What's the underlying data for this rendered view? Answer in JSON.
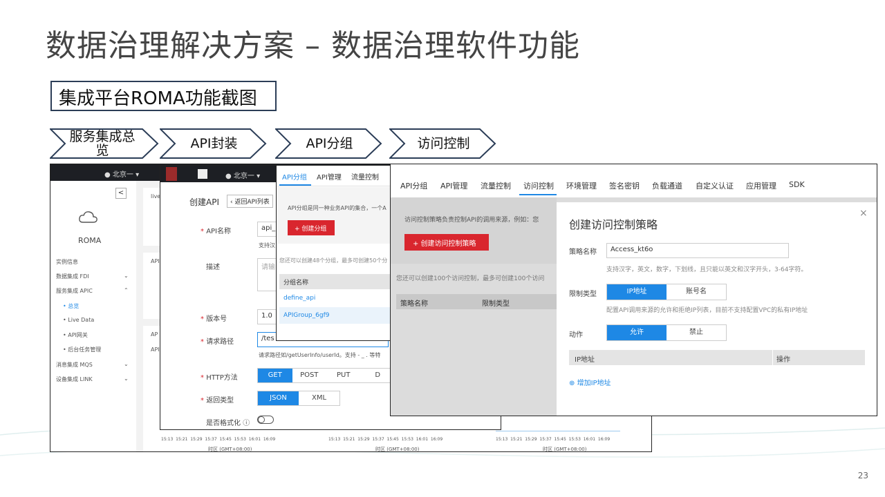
{
  "slide": {
    "title": "数据治理解决方案 – 数据治理软件功能",
    "subtitle": "集成平台ROMA功能截图",
    "page_number": "23"
  },
  "steps": [
    "服务集成总览",
    "API封装",
    "API分组",
    "访问控制"
  ],
  "win1": {
    "region": "北京一",
    "logo_text": "ROMA",
    "sidebar": [
      "实例信息",
      "数据集成 FDI",
      "服务集成 APIC",
      "• 总览",
      "• Live Data",
      "• API网关",
      "• 后台任务管理",
      "消息集成 MQS",
      "设备集成 LINK"
    ],
    "card_labels": [
      "live",
      "API",
      "AP",
      "API"
    ],
    "time_ticks": [
      "15:13",
      "15:21",
      "15:29",
      "15:37",
      "15:45",
      "15:53",
      "16:01",
      "16:09"
    ],
    "time_zone": "时区 (GMT+08:00)",
    "y_tick": "15"
  },
  "win2": {
    "region": "北京一",
    "page_title": "创建API",
    "back_label": "返回API列表",
    "api_name_label": "API名称",
    "api_name_value": "api_",
    "api_name_hint": "支持汉",
    "desc_label": "描述",
    "desc_placeholder": "请输",
    "version_label": "版本号",
    "version_value": "1.0",
    "path_label": "请求路径",
    "path_value": "/tes",
    "path_hint": "请求路径如/getUserInfo/userId。支持 - _ . 等特",
    "method_label": "HTTP方法",
    "methods": [
      "GET",
      "POST",
      "PUT",
      "D"
    ],
    "return_label": "返回类型",
    "return_types": [
      "JSON",
      "XML"
    ],
    "format_label": "是否格式化"
  },
  "win3": {
    "tabs": [
      "API分组",
      "API管理",
      "流量控制"
    ],
    "info": "API分组是同一种业务API的集合，一个A",
    "create_btn": "+ 创建分组",
    "quota": "您还可以创建48个分组，最多可创建50个分",
    "col_header": "分组名称",
    "rows": [
      "define_api",
      "APIGroup_6gf9"
    ]
  },
  "win4": {
    "tabs": [
      "API分组",
      "API管理",
      "流量控制",
      "访问控制",
      "环境管理",
      "签名密钥",
      "负载通道",
      "自定义认证",
      "应用管理",
      "SDK"
    ],
    "info": "访问控制策略负责控制API的调用来源，例如：您",
    "create_btn": "+ 创建访问控制策略",
    "quota": "您还可以创建100个访问控制，最多可创建100个访问",
    "col1": "策略名称",
    "col2": "限制类型",
    "dialog": {
      "title": "创建访问控制策略",
      "close": "×",
      "name_label": "策略名称",
      "name_value": "Access_kt6o",
      "name_hint": "支持汉字，英文，数字，下划线，且只能以英文和汉字开头，3-64字符。",
      "type_label": "限制类型",
      "type_options": [
        "IP地址",
        "账号名"
      ],
      "type_hint": "配置API调用来源的允许和拒绝IP列表，目前不支持配置VPC的私有IP地址",
      "action_label": "动作",
      "action_options": [
        "允许",
        "禁止"
      ],
      "ip_col": "IP地址",
      "op_col": "操作",
      "add_ip": "增加IP地址"
    }
  }
}
